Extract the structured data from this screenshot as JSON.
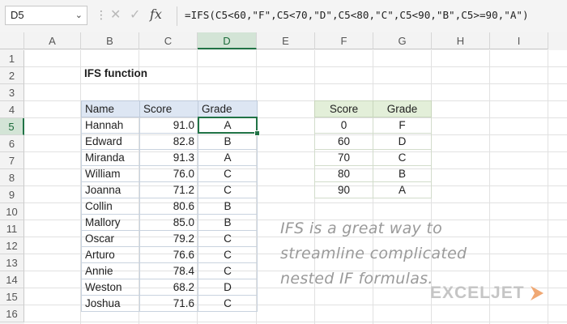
{
  "formula_bar": {
    "name_box": "D5",
    "separator": "⋮",
    "cancel_icon": "cancel-x-icon",
    "enter_icon": "enter-check-icon",
    "fx_label": "fx",
    "formula": "=IFS(C5<60,\"F\",C5<70,\"D\",C5<80,\"C\",C5<90,\"B\",C5>=90,\"A\")"
  },
  "columns": [
    "A",
    "B",
    "C",
    "D",
    "E",
    "F",
    "G",
    "H",
    "I"
  ],
  "rows": [
    "1",
    "2",
    "3",
    "4",
    "5",
    "6",
    "7",
    "8",
    "9",
    "10",
    "11",
    "12",
    "13",
    "14",
    "15",
    "16"
  ],
  "selected_column": "D",
  "selected_row": "5",
  "title": "IFS function",
  "main_table": {
    "headers": [
      "Name",
      "Score",
      "Grade"
    ],
    "rows": [
      {
        "name": "Hannah",
        "score": "91.0",
        "grade": "A"
      },
      {
        "name": "Edward",
        "score": "82.8",
        "grade": "B"
      },
      {
        "name": "Miranda",
        "score": "91.3",
        "grade": "A"
      },
      {
        "name": "William",
        "score": "76.0",
        "grade": "C"
      },
      {
        "name": "Joanna",
        "score": "71.2",
        "grade": "C"
      },
      {
        "name": "Collin",
        "score": "80.6",
        "grade": "B"
      },
      {
        "name": "Mallory",
        "score": "85.0",
        "grade": "B"
      },
      {
        "name": "Oscar",
        "score": "79.2",
        "grade": "C"
      },
      {
        "name": "Arturo",
        "score": "76.6",
        "grade": "C"
      },
      {
        "name": "Annie",
        "score": "78.4",
        "grade": "C"
      },
      {
        "name": "Weston",
        "score": "68.2",
        "grade": "D"
      },
      {
        "name": "Joshua",
        "score": "71.6",
        "grade": "C"
      }
    ]
  },
  "key_table": {
    "headers": [
      "Score",
      "Grade"
    ],
    "rows": [
      {
        "score": "0",
        "grade": "F"
      },
      {
        "score": "60",
        "grade": "D"
      },
      {
        "score": "70",
        "grade": "C"
      },
      {
        "score": "80",
        "grade": "B"
      },
      {
        "score": "90",
        "grade": "A"
      }
    ]
  },
  "note": {
    "line1": "IFS is a great way to",
    "line2": "streamline complicated",
    "line3": "nested IF formulas."
  },
  "logo": {
    "text": "EXCELJET",
    "mark_icon": "exceljet-arrow-icon"
  },
  "colors": {
    "selection_green": "#217346",
    "header_blue": "#dde6f3",
    "header_green": "#e3efd9",
    "note_gray": "#9a9a9a"
  }
}
